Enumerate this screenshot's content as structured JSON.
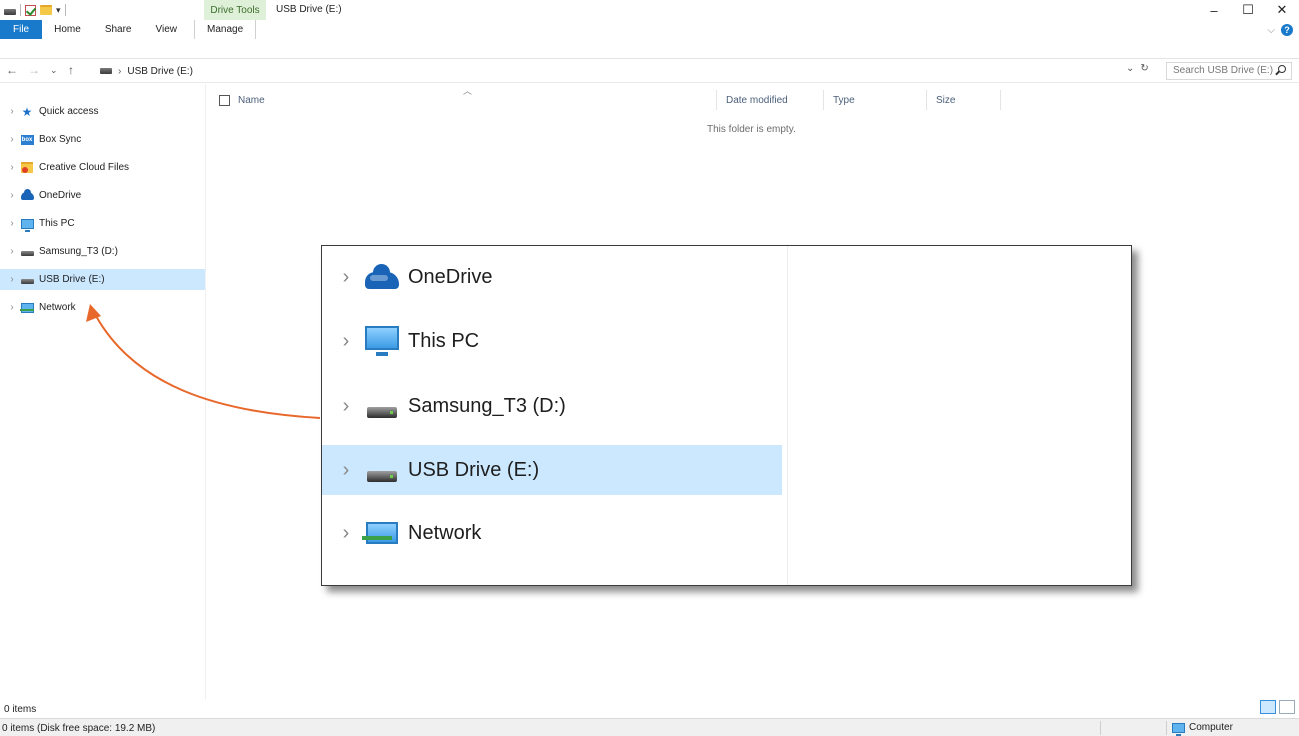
{
  "window": {
    "title": "USB Drive (E:)",
    "contextual_tab": "Drive Tools",
    "controls": {
      "minimize": "–",
      "maximize": "☐",
      "close": "✕"
    }
  },
  "ribbon": {
    "tabs": [
      {
        "label": "File"
      },
      {
        "label": "Home"
      },
      {
        "label": "Share"
      },
      {
        "label": "View"
      },
      {
        "label": "Manage"
      }
    ]
  },
  "address": {
    "path": "USB Drive (E:)",
    "search_placeholder": "Search USB Drive (E:)"
  },
  "nav": {
    "items": [
      {
        "label": "Quick access",
        "icon": "star-icon"
      },
      {
        "label": "Box Sync",
        "icon": "box-icon"
      },
      {
        "label": "Creative Cloud Files",
        "icon": "creative-cloud-icon"
      },
      {
        "label": "OneDrive",
        "icon": "onedrive-icon"
      },
      {
        "label": "This PC",
        "icon": "computer-icon"
      },
      {
        "label": "Samsung_T3 (D:)",
        "icon": "drive-icon"
      },
      {
        "label": "USB Drive (E:)",
        "icon": "drive-icon",
        "selected": true
      },
      {
        "label": "Network",
        "icon": "network-icon"
      }
    ]
  },
  "filelist": {
    "columns": [
      {
        "label": "Name"
      },
      {
        "label": "Date modified"
      },
      {
        "label": "Type"
      },
      {
        "label": "Size"
      }
    ],
    "empty_message": "This folder is empty."
  },
  "status": {
    "item_count": "0 items",
    "details": "0 items (Disk free space: 19.2 MB)",
    "zone": "Computer"
  },
  "zoom": {
    "items": [
      {
        "label": "OneDrive",
        "icon": "onedrive-icon"
      },
      {
        "label": "This PC",
        "icon": "computer-icon"
      },
      {
        "label": "Samsung_T3 (D:)",
        "icon": "drive-icon"
      },
      {
        "label": "USB Drive (E:)",
        "icon": "drive-icon",
        "selected": true
      },
      {
        "label": "Network",
        "icon": "network-icon"
      }
    ]
  },
  "colors": {
    "selection": "#cce8ff",
    "file_tab": "#1979ca",
    "callout_arrow": "#e8672a"
  }
}
